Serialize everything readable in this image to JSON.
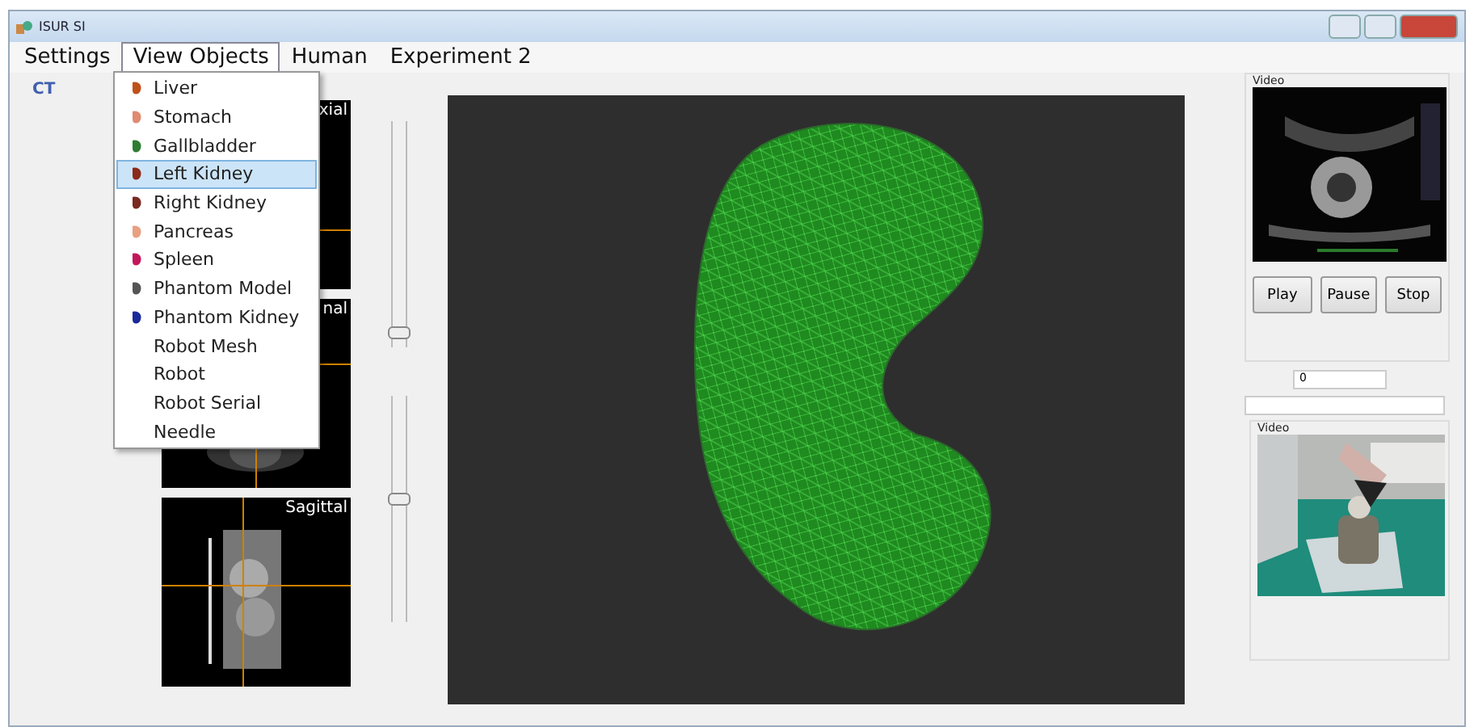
{
  "window": {
    "title": "ISUR SI"
  },
  "menu_bar": [
    {
      "label": "Settings",
      "selected": false
    },
    {
      "label": "View Objects",
      "selected": true
    },
    {
      "label": "Human",
      "selected": false
    },
    {
      "label": "Experiment 2",
      "selected": false
    }
  ],
  "section_label": "CT",
  "dropdown": [
    {
      "label": "Liver",
      "selected": false,
      "color": "#c0501a"
    },
    {
      "label": "Stomach",
      "selected": false,
      "color": "#e08a70"
    },
    {
      "label": "Gallbladder",
      "selected": false,
      "color": "#2e7d32"
    },
    {
      "label": "Left Kidney",
      "selected": true,
      "color": "#8b2a1a"
    },
    {
      "label": "Right Kidney",
      "selected": false,
      "color": "#7a2a20"
    },
    {
      "label": "Pancreas",
      "selected": false,
      "color": "#e8a080"
    },
    {
      "label": "Spleen",
      "selected": false,
      "color": "#c2185b"
    },
    {
      "label": "Phantom Model",
      "selected": false,
      "color": "#555555"
    },
    {
      "label": "Phantom Kidney",
      "selected": false,
      "color": "#1a2a9a"
    },
    {
      "label": "Robot Mesh",
      "selected": false
    },
    {
      "label": "Robot",
      "selected": false
    },
    {
      "label": "Robot Serial",
      "selected": false
    },
    {
      "label": "Needle",
      "selected": false
    }
  ],
  "ct_views": [
    {
      "label": "xial"
    },
    {
      "label": "nal"
    },
    {
      "label": "Sagittal"
    }
  ],
  "sliders": [
    {
      "level": 0.05
    },
    {
      "level": 0.55
    }
  ],
  "video_panel": {
    "title": "Video",
    "buttons": [
      "Play",
      "Pause",
      "Stop"
    ]
  },
  "frame_field": {
    "value": "0"
  },
  "camera_panel": {
    "title": "Video"
  }
}
